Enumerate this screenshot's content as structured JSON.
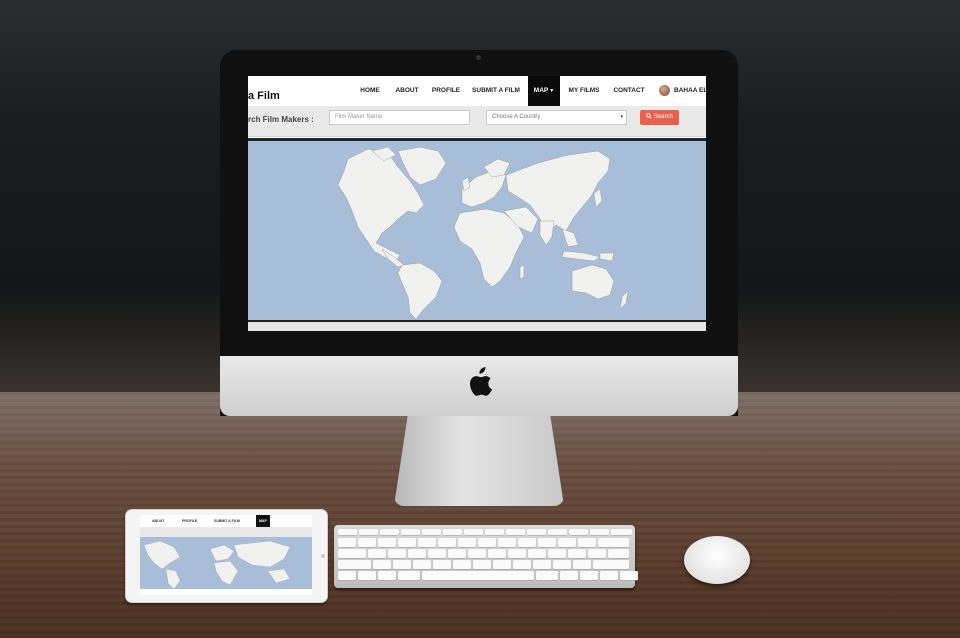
{
  "website": {
    "brand": "a Film",
    "nav_items": [
      {
        "label": "HOME"
      },
      {
        "label": "ABOUT"
      },
      {
        "label": "PROFILE"
      },
      {
        "label": "SUBMIT A FILM"
      },
      {
        "label": "MAP",
        "active": true
      },
      {
        "label": "MY FILMS"
      },
      {
        "label": "CONTACT"
      }
    ],
    "user_name": "BAHAA ELG",
    "search": {
      "label": "rch Film Makers :",
      "maker_placeholder": "Film Maker Name",
      "country_selected": "Choose A Country",
      "button_label": "Search"
    }
  },
  "tablet_site": {
    "nav_items": [
      {
        "label": "ABOUT"
      },
      {
        "label": "PROFILE"
      },
      {
        "label": "SUBMIT A FILM"
      },
      {
        "label": "MAP",
        "active": true
      }
    ]
  },
  "colors": {
    "accent": "#e8604e",
    "ocean": "#a8bdd8",
    "land": "#f1f1ef",
    "nav_active": "#0a0a0a"
  },
  "icons": {
    "search_button_icon": "search-icon",
    "nav_caret": "caret-down-icon",
    "monitor_logo": "apple-logo-icon"
  }
}
